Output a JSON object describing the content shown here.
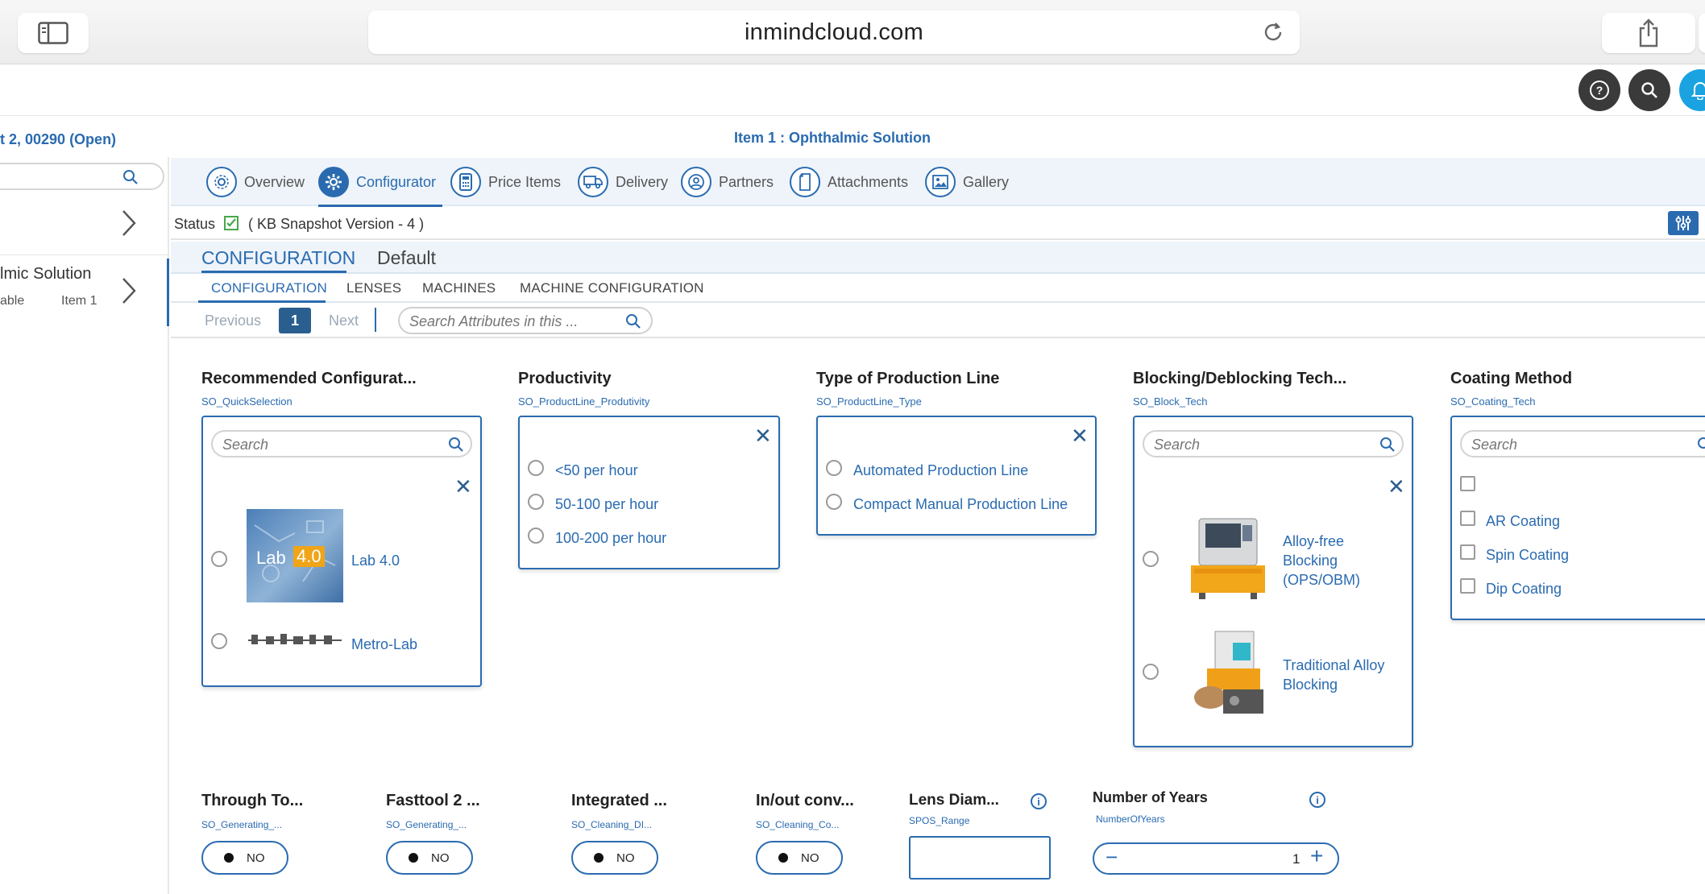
{
  "browser": {
    "url": "inmindcloud.com"
  },
  "header": {
    "left_title": "t 2, 00290 (Open)",
    "center_title": "Item 1 : Ophthalmic Solution"
  },
  "left_panel": {
    "item2_title": "lmic Solution",
    "item2_sub_left": "able",
    "item2_sub_right": "Item 1"
  },
  "tabs": [
    {
      "label": "Overview",
      "icon": "overview-icon"
    },
    {
      "label": "Configurator",
      "icon": "gear-icon"
    },
    {
      "label": "Price Items",
      "icon": "calculator-icon"
    },
    {
      "label": "Delivery",
      "icon": "truck-icon"
    },
    {
      "label": "Partners",
      "icon": "person-icon"
    },
    {
      "label": "Attachments",
      "icon": "document-icon"
    },
    {
      "label": "Gallery",
      "icon": "image-icon"
    }
  ],
  "status": {
    "label": "Status",
    "version": "( KB Snapshot Version - 4 )"
  },
  "config": {
    "title": "CONFIGURATION",
    "default": "Default",
    "subtabs": [
      "CONFIGURATION",
      "LENSES",
      "MACHINES",
      "MACHINE CONFIGURATION"
    ]
  },
  "pager": {
    "previous": "Previous",
    "page": "1",
    "next": "Next",
    "search_placeholder": "Search Attributes in this ..."
  },
  "attributes": {
    "recommended": {
      "title": "Recommended Configurat...",
      "code": "SO_QuickSelection",
      "search_placeholder": "Search",
      "options": [
        "Lab 4.0",
        "Metro-Lab"
      ],
      "lab_image_text": "Lab",
      "lab_image_badge": "4.0"
    },
    "productivity": {
      "title": "Productivity",
      "code": "SO_ProductLine_Produtivity",
      "options": [
        "<50 per hour",
        "50-100 per hour",
        "100-200 per hour"
      ]
    },
    "production_line": {
      "title": "Type of Production Line",
      "code": "SO_ProductLine_Type",
      "options": [
        "Automated Production Line",
        "Compact Manual Production Line"
      ]
    },
    "blocking": {
      "title": "Blocking/Deblocking Tech...",
      "code": "SO_Block_Tech",
      "search_placeholder": "Search",
      "options": [
        "Alloy-free Blocking (OPS/OBM)",
        "Traditional Alloy Blocking"
      ]
    },
    "coating": {
      "title": "Coating Method",
      "code": "SO_Coating_Tech",
      "search_placeholder": "Search",
      "options": [
        "AR Coating",
        "Spin Coating",
        "Dip Coating"
      ]
    }
  },
  "bottom": [
    {
      "title": "Through To...",
      "code": "SO_Generating_...",
      "value": "NO"
    },
    {
      "title": "Fasttool 2 ...",
      "code": "SO_Generating_...",
      "value": "NO"
    },
    {
      "title": "Integrated ...",
      "code": "SO_Cleaning_DI...",
      "value": "NO"
    },
    {
      "title": "In/out conv...",
      "code": "SO_Cleaning_Co...",
      "value": "NO"
    }
  ],
  "lens": {
    "title": "Lens Diam...",
    "code": "SPOS_Range",
    "value": ""
  },
  "years": {
    "title": "Number of Years",
    "code": "NumberOfYears",
    "value": "1",
    "minus": "−",
    "plus": "+"
  },
  "colors": {
    "accent": "#2a6bb0",
    "dark_accent": "#2a5e8f",
    "notification": "#1aa3e0"
  }
}
